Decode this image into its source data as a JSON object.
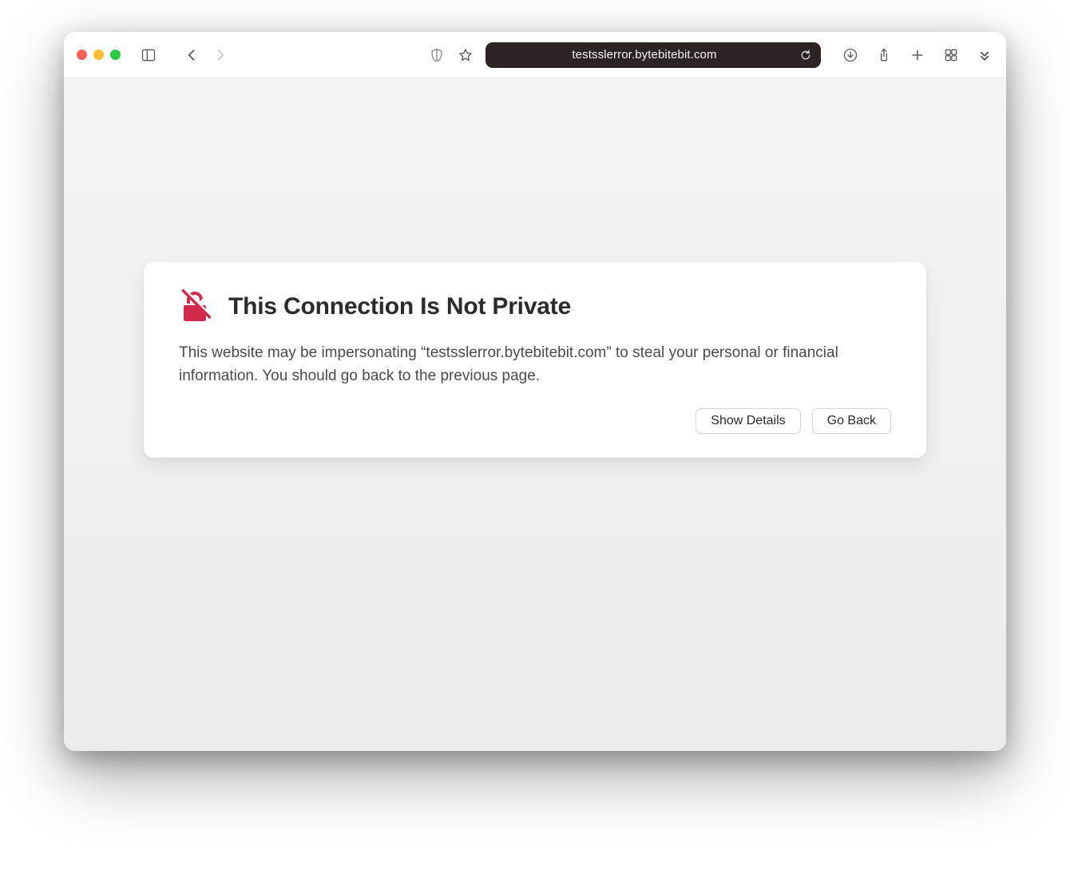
{
  "toolbar": {
    "address": "testsslerror.bytebitebit.com"
  },
  "error": {
    "title": "This Connection Is Not Private",
    "body": "This website may be impersonating “testsslerror.bytebitebit.com” to steal your personal or financial information. You should go back to the previous page.",
    "show_details_label": "Show Details",
    "go_back_label": "Go Back"
  }
}
